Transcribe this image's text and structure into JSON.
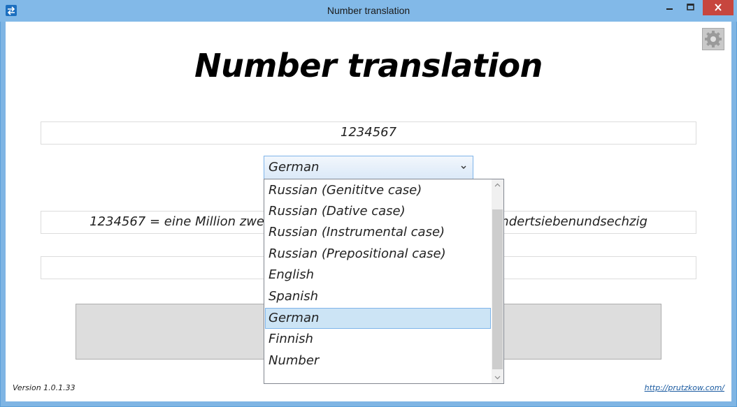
{
  "window": {
    "title": "Number translation",
    "minimize_glyph": "—",
    "maximize_glyph": "▭",
    "close_glyph": "✕"
  },
  "app": {
    "heading": "Number translation",
    "number_value": "1234567",
    "result_value": "1234567 = eine Million zweihundertvierunddreißigtausendfünfhundertsiebenundsechzig",
    "extra_value": "",
    "version": "Version 1.0.1.33",
    "link": "http://prutzkow.com/"
  },
  "language_select": {
    "selected": "German",
    "options": [
      "Russian (Genititve case)",
      "Russian (Dative case)",
      "Russian (Instrumental case)",
      "Russian (Prepositional case)",
      "English",
      "Spanish",
      "German",
      "Finnish",
      "Number"
    ]
  },
  "icons": {
    "app": "app-swap-icon",
    "settings": "gear-icon",
    "dropdown": "chevron-down-icon"
  },
  "colors": {
    "titlebar": "#82b9e8",
    "close": "#c7463e",
    "selection": "#cce4f5",
    "select_border": "#7eb4ea"
  }
}
